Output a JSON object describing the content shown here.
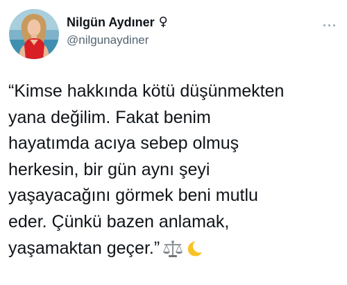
{
  "tweet": {
    "author": {
      "display_name": "Nilgün Aydıner",
      "gender_symbol": "♀",
      "handle": "@nilgunaydiner",
      "avatar_icon": "profile-photo",
      "name_color": "#0f1419",
      "handle_color": "#536471"
    },
    "more_icon": "more-dots-icon",
    "text_lines": [
      "“Kimse hakkında kötü düşünmekten",
      "yana değilim. Fakat benim",
      "hayatımda acıya sebep olmuş",
      "herkesin, bir gün aynı şeyi",
      "yaşayacağını görmek beni mutlu",
      "eder. Çünkü bazen anlamak,",
      "yaşamaktan geçer.”"
    ],
    "emojis": [
      "scales-emoji",
      "crescent-moon-emoji"
    ],
    "background_color": "#ffffff",
    "text_color": "#0f1419"
  }
}
